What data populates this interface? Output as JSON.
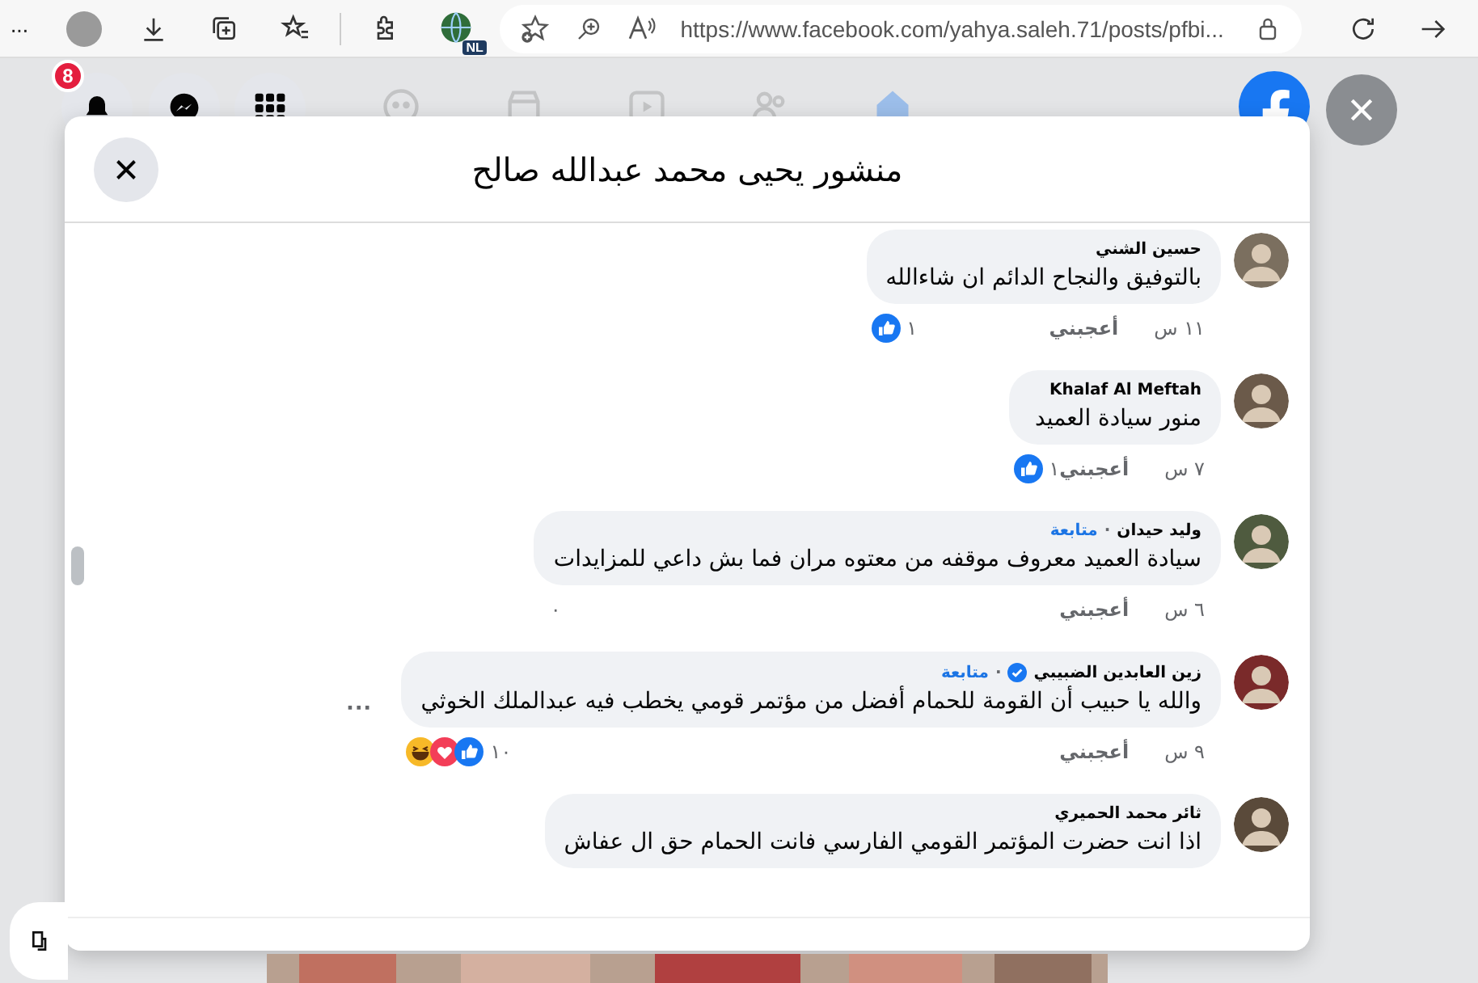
{
  "browser": {
    "menu": "···",
    "profile_badge": "NL",
    "url": "https://www.facebook.com/yahya.saleh.71/posts/pfbi..."
  },
  "header": {
    "notification_count": "8"
  },
  "dialog": {
    "title": "منشور يحيى محمد عبدالله صالح",
    "comments": [
      {
        "name": "حسين الشني",
        "verified": false,
        "text": "بالتوفيق والنجاح الدائم ان شاءالله",
        "time": "١١ س",
        "like": "أعجبني",
        "reactions": [
          {
            "kind": "like"
          }
        ],
        "count": "١"
      },
      {
        "name": "Khalaf Al Meftah",
        "verified": false,
        "text": "منور سيادة العميد",
        "time": "٧ س",
        "like": "أعجبني",
        "reactions": [
          {
            "kind": "like"
          }
        ],
        "count": "١"
      },
      {
        "name": "وليد حيدان",
        "verified": false,
        "separator": "·",
        "follow": "متابعة",
        "text": "سيادة العميد معروف موقفه من معتوه مران فما بش داعي للمزايدات",
        "time": "٦ س",
        "like": "أعجبني",
        "count": "٠"
      },
      {
        "name": "زين العابدين الضبيبي",
        "verified": true,
        "separator": "·",
        "follow": "متابعة",
        "text": "والله يا حبيب أن القومة للحمام أفضل من مؤتمر قومي يخطب فيه عبدالملك الخوثي",
        "time": "٩ س",
        "like": "أعجبني",
        "reactions": [
          {
            "kind": "haha"
          },
          {
            "kind": "love"
          },
          {
            "kind": "like"
          }
        ],
        "count": "١٠",
        "more": "···"
      },
      {
        "name": "ثائر محمد الحميري",
        "verified": false,
        "text": "اذا انت حضرت المؤتمر القومي الفارسي فانت الحمام حق ال عفاش"
      }
    ]
  }
}
